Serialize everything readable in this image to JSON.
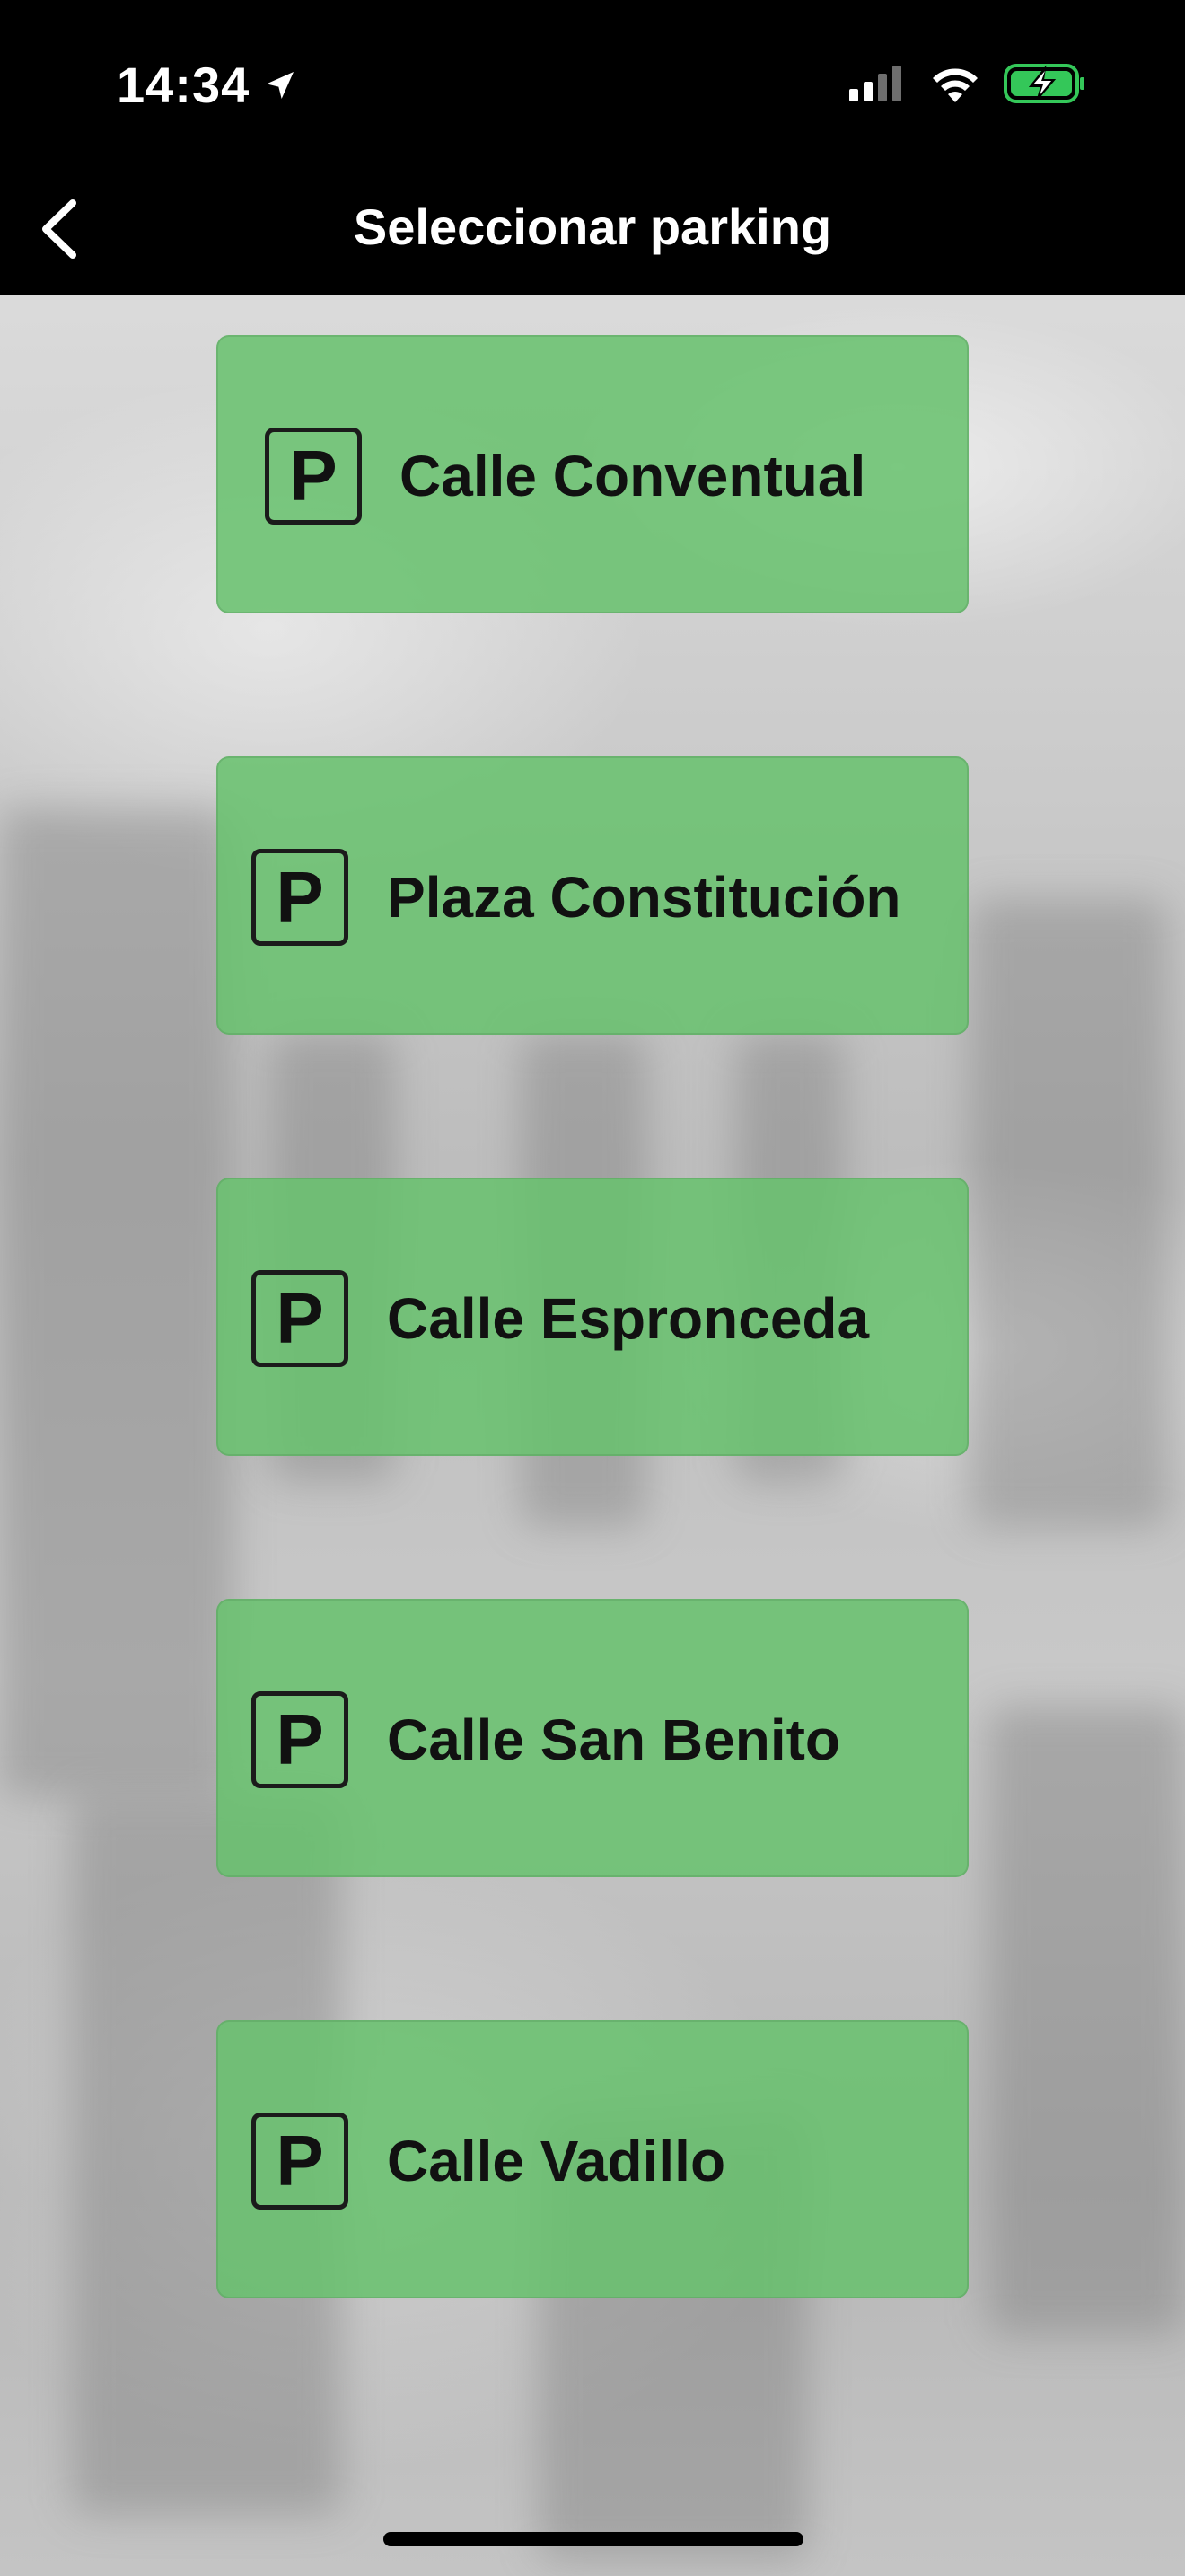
{
  "status_bar": {
    "time": "14:34",
    "icons": [
      "location-arrow-icon",
      "cellular-signal-icon",
      "wifi-icon",
      "battery-charging-icon"
    ]
  },
  "header": {
    "title": "Seleccionar parking",
    "back_icon": "chevron-left-icon"
  },
  "parkings": [
    {
      "label": "Calle Conventual",
      "icon": "parking-icon",
      "icon_letter": "P"
    },
    {
      "label": "Plaza Constitución",
      "icon": "parking-icon",
      "icon_letter": "P"
    },
    {
      "label": "Calle Espronceda",
      "icon": "parking-icon",
      "icon_letter": "P"
    },
    {
      "label": "Calle San Benito",
      "icon": "parking-icon",
      "icon_letter": "P"
    },
    {
      "label": "Calle Vadillo",
      "icon": "parking-icon",
      "icon_letter": "P"
    }
  ],
  "colors": {
    "header_background": "#000000",
    "button_green": "#68C16E",
    "battery_green": "#34C759"
  }
}
